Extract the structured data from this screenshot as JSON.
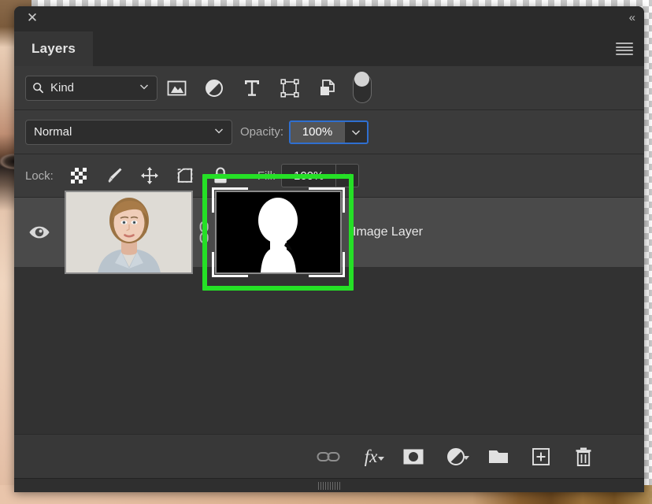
{
  "window": {
    "close_icon": "close-icon",
    "collapse_icon": "double-chevron-left-icon",
    "menu_icon": "panel-menu-icon"
  },
  "tabs": [
    {
      "label": "Layers",
      "active": true
    }
  ],
  "filter": {
    "search_icon": "search-icon",
    "kind_label": "Kind",
    "chevron": "chevron-down-icon",
    "type_filters": [
      {
        "name": "filter-pixel-layers",
        "icon": "image-icon"
      },
      {
        "name": "filter-adjustment-layers",
        "icon": "adjustment-circle-icon"
      },
      {
        "name": "filter-type-layers",
        "icon": "type-t-icon"
      },
      {
        "name": "filter-shape-layers",
        "icon": "shape-bounds-icon"
      },
      {
        "name": "filter-smart-objects",
        "icon": "smart-object-icon"
      }
    ],
    "toggle_name": "filter-enable-toggle"
  },
  "blend": {
    "mode": "Normal",
    "chevron": "chevron-down-icon",
    "opacity_label": "Opacity:",
    "opacity_value": "100%",
    "opacity_focused": true,
    "opacity_stepper_icon": "chevron-down-icon"
  },
  "lock": {
    "label": "Lock:",
    "buttons": [
      {
        "name": "lock-transparent-pixels",
        "icon": "checkerboard-icon"
      },
      {
        "name": "lock-image-pixels",
        "icon": "brush-icon"
      },
      {
        "name": "lock-position",
        "icon": "move-arrows-icon"
      },
      {
        "name": "lock-artboard-nesting",
        "icon": "artboard-icon"
      },
      {
        "name": "lock-all",
        "icon": "padlock-icon"
      }
    ],
    "fill_label": "Fill:",
    "fill_value": "100%",
    "fill_stepper_icon": "chevron-down-icon"
  },
  "layers": [
    {
      "name": "Image Layer",
      "visible": true,
      "visibility_icon": "eye-icon",
      "linked": true,
      "link_icon": "chain-link-icon",
      "mask_selected": true,
      "highlight_color": "#25e026",
      "thumbnail": "portrait-photo-thumbnail",
      "mask_thumbnail": "layer-mask-thumbnail"
    }
  ],
  "bottom_toolbar": [
    {
      "name": "link-layers-button",
      "icon": "chain-link-icon",
      "has_menu": false
    },
    {
      "name": "layer-styles-button",
      "icon": "fx-icon",
      "has_menu": true
    },
    {
      "name": "add-layer-mask-button",
      "icon": "mask-icon",
      "has_menu": false
    },
    {
      "name": "new-fill-adjustment-layer-button",
      "icon": "adjustment-circle-icon",
      "has_menu": true
    },
    {
      "name": "new-group-button",
      "icon": "folder-icon",
      "has_menu": false
    },
    {
      "name": "new-layer-button",
      "icon": "plus-square-icon",
      "has_menu": false
    },
    {
      "name": "delete-layer-button",
      "icon": "trash-icon",
      "has_menu": false
    }
  ],
  "fx_label": "fx"
}
